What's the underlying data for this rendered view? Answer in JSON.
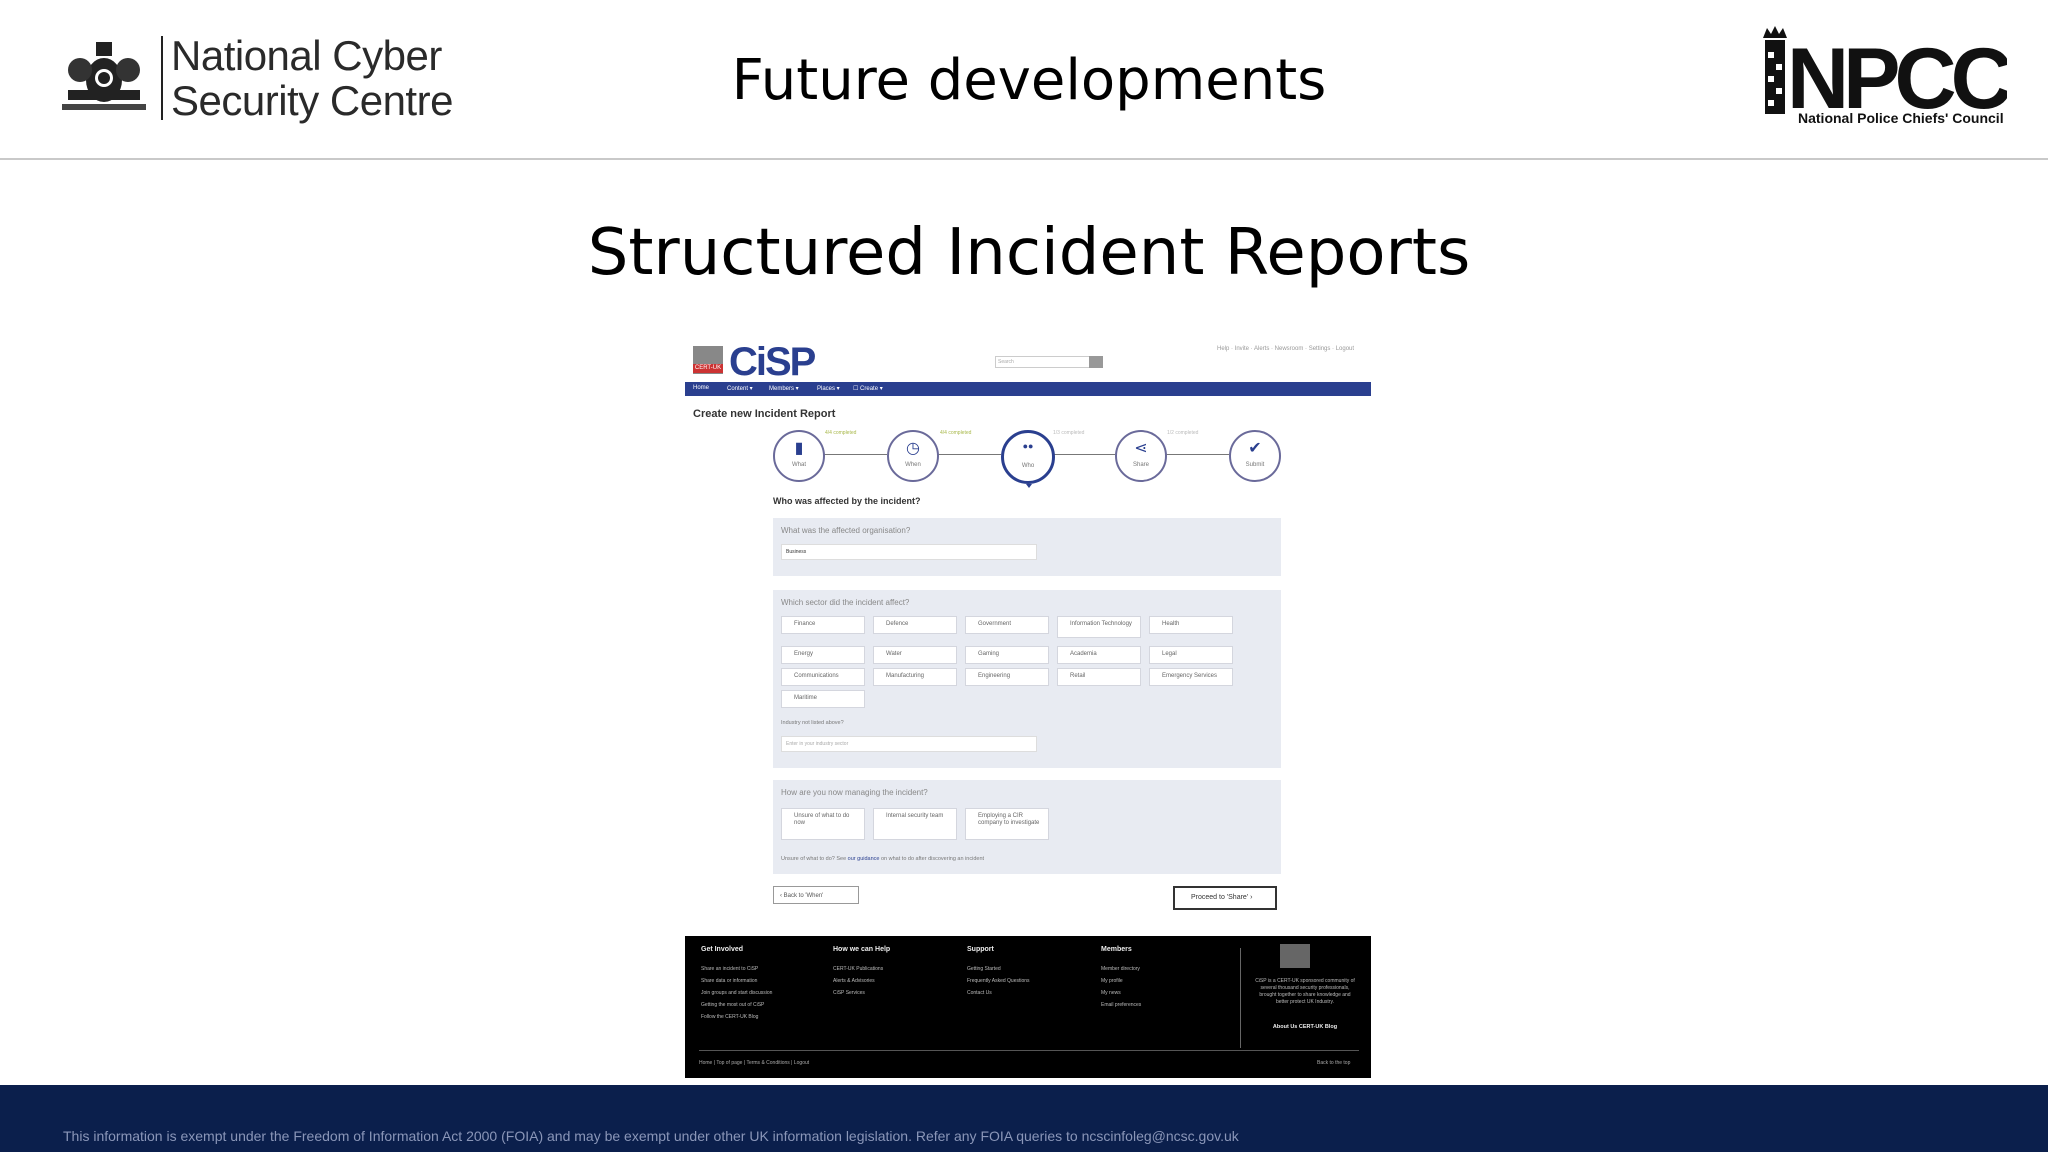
{
  "slide": {
    "title": "Future developments",
    "subtitle": "Structured Incident Reports",
    "ncsc_logo": {
      "line1": "National Cyber",
      "line2": "Security Centre"
    },
    "npcc_logo": {
      "wordmark": "NPCC",
      "subtitle": "National Police Chiefs' Council"
    },
    "disclaimer": "This information is exempt under the Freedom of Information Act 2000 (FOIA) and may be exempt under other UK information legislation. Refer any FOIA queries to ncscinfoleg@ncsc.gov.uk"
  },
  "screenshot": {
    "brand": {
      "name": "CiSP",
      "badge": "CERT-UK"
    },
    "search_placeholder": "Search",
    "top_links": "Help · Invite · Alerts · Newsroom · Settings · Logout",
    "nav": [
      "Home",
      "Content ▾",
      "Members ▾",
      "Places ▾",
      "☐ Create ▾"
    ],
    "form_title": "Create new Incident Report",
    "steps": [
      {
        "label": "What",
        "icon": "document-icon",
        "glyph": "▮",
        "note": "4/4 completed"
      },
      {
        "label": "When",
        "icon": "clock-icon",
        "glyph": "◷",
        "note": "4/4 completed"
      },
      {
        "label": "Who",
        "icon": "people-icon",
        "glyph": "●●",
        "note": "1/3 completed"
      },
      {
        "label": "Share",
        "icon": "share-icon",
        "glyph": "⋖",
        "note": "1/2 completed"
      },
      {
        "label": "Submit",
        "icon": "check-icon",
        "glyph": "✔",
        "note": ""
      }
    ],
    "who_question": "Who was affected by the incident?",
    "org_question": "What was the affected organisation?",
    "org_value": "Business",
    "sector_question": "Which sector did the incident affect?",
    "sectors": [
      "Finance",
      "Defence",
      "Government",
      "Information Technology",
      "Health",
      "Energy",
      "Water",
      "Gaming",
      "Academia",
      "Legal",
      "Communications",
      "Manufacturing",
      "Engineering",
      "Retail",
      "Emergency Services",
      "Maritime"
    ],
    "industry_label": "Industry not listed above?",
    "industry_placeholder": "Enter in your industry sector",
    "manage_question": "How are you now managing the incident?",
    "manage_options": [
      "Unsure of what to do now",
      "Internal security team",
      "Employing a CIR company to investigate"
    ],
    "manage_hint_prefix": "Unsure of what to do? See",
    "manage_hint_link": "our guidance",
    "manage_hint_suffix": "on what to do after discovering an incident",
    "back_button": "Back to 'When'",
    "proceed_button": "Proceed to 'Share'",
    "footer": {
      "columns": [
        {
          "heading": "Get Involved",
          "links": [
            "Share an incident to CiSP",
            "Share data or information",
            "Join groups and start discussion",
            "Getting the most out of CiSP",
            "Follow the CERT-UK Blog"
          ]
        },
        {
          "heading": "How we can Help",
          "links": [
            "CERT-UK Publications",
            "Alerts & Advisories",
            "CiSP Services"
          ]
        },
        {
          "heading": "Support",
          "links": [
            "Getting Started",
            "Frequently Asked Questions",
            "Contact Us"
          ]
        },
        {
          "heading": "Members",
          "links": [
            "Member directory",
            "My profile",
            "My news",
            "Email preferences"
          ]
        }
      ],
      "about_text": "CiSP is a CERT-UK sponsored community of several thousand security professionals, brought together to share knowledge and better protect UK Industry.",
      "about_link": "About Us CERT-UK Blog",
      "bottom_links": "Home  |  Top of page  |  Terms & Conditions  |  Logout",
      "back_to_top": "Back to the top"
    }
  }
}
